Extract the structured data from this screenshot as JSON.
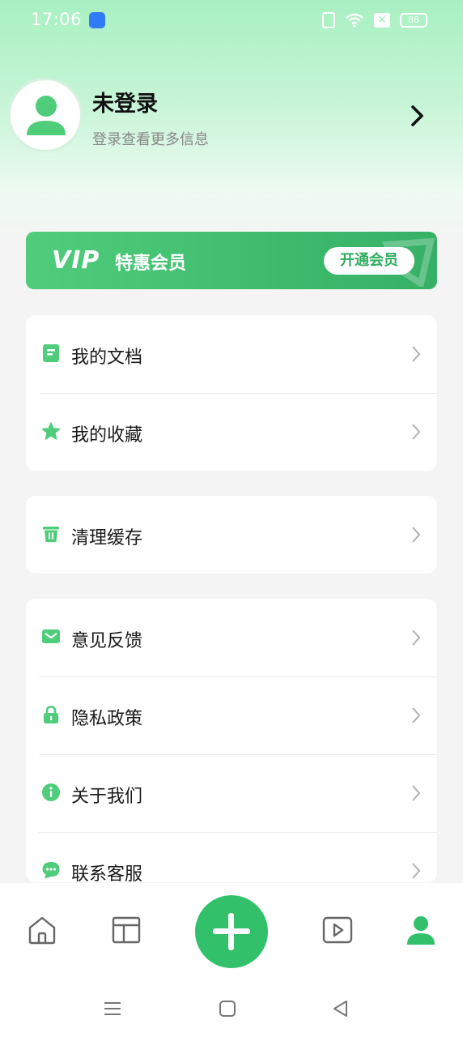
{
  "status_bar": {
    "time": "17:06",
    "battery": "88"
  },
  "profile": {
    "name": "未登录",
    "subtitle": "登录查看更多信息"
  },
  "vip": {
    "logo": "VIP",
    "title": "特惠会员",
    "button": "开通会员"
  },
  "menu_groups": [
    [
      {
        "icon": "document-icon",
        "label": "我的文档"
      },
      {
        "icon": "star-icon",
        "label": "我的收藏"
      }
    ],
    [
      {
        "icon": "trash-icon",
        "label": "清理缓存"
      }
    ],
    [
      {
        "icon": "mail-icon",
        "label": "意见反馈"
      },
      {
        "icon": "lock-icon",
        "label": "隐私政策"
      },
      {
        "icon": "info-icon",
        "label": "关于我们"
      },
      {
        "icon": "chat-icon",
        "label": "联系客服"
      }
    ]
  ],
  "colors": {
    "accent": "#33c06b",
    "icon_green": "#4fcd7b"
  },
  "bottom_nav": [
    "home-icon",
    "layout-icon",
    "add-icon",
    "video-icon",
    "profile-icon"
  ]
}
